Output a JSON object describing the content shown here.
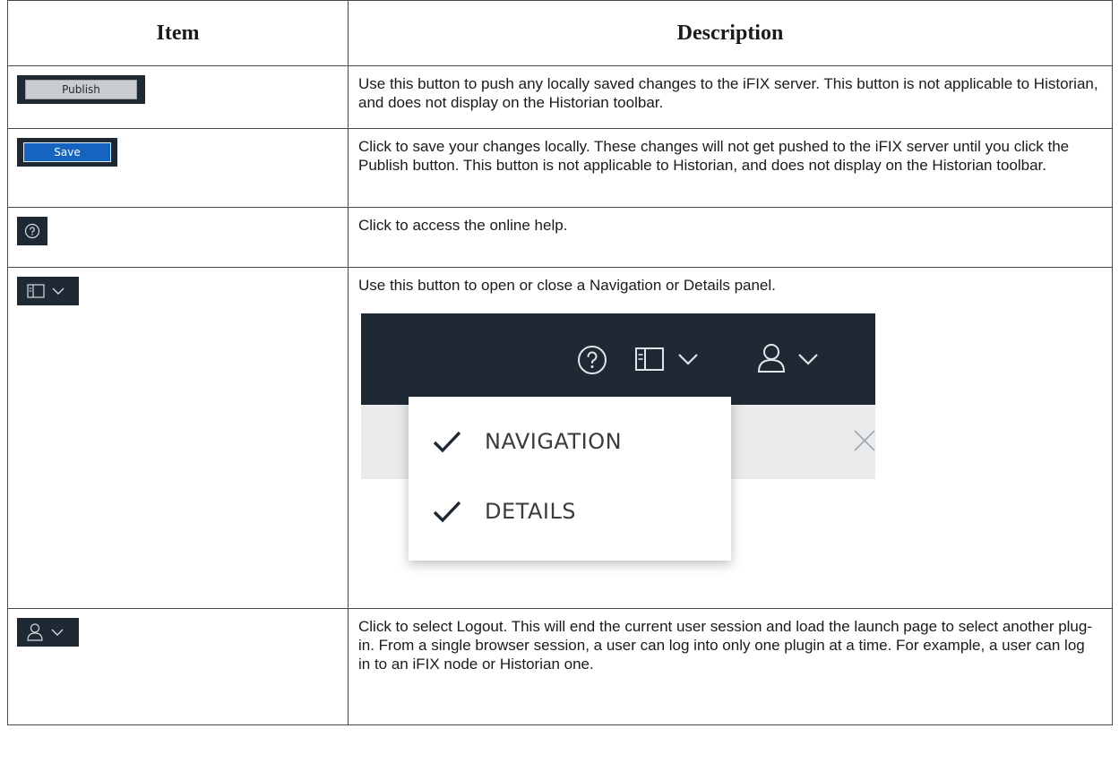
{
  "table": {
    "headers": {
      "item": "Item",
      "description": "Description"
    },
    "rows": [
      {
        "button_label": "Publish",
        "description": "Use this button to push any locally saved changes to the iFIX server. This button is not applicable to Historian, and does not display on the Historian toolbar."
      },
      {
        "button_label": "Save",
        "description": "Click to save your changes locally. These changes will not get pushed to the iFIX server until you click the Publish button. This button is not applicable to Historian, and does not display on the Historian toolbar."
      },
      {
        "icon": "help-icon",
        "description": "Click to access the online help."
      },
      {
        "icon": "panel-toggle-icon",
        "description": "Use this button to open or close a Navigation or Details panel.",
        "menu": {
          "items": [
            {
              "label": "NAVIGATION",
              "checked": true
            },
            {
              "label": "DETAILS",
              "checked": true
            }
          ]
        }
      },
      {
        "icon": "user-icon",
        "description": "Click to select Logout. This will end the current user session and load the launch page to select another plug-in. From a single browser session, a user can log into only one plugin at a time. For example, a user can log in to an iFIX node or Historian one."
      }
    ]
  },
  "colors": {
    "toolbar_dark": "#1f2933",
    "save_blue": "#1565c0",
    "publish_gray": "#c8ccd0"
  }
}
